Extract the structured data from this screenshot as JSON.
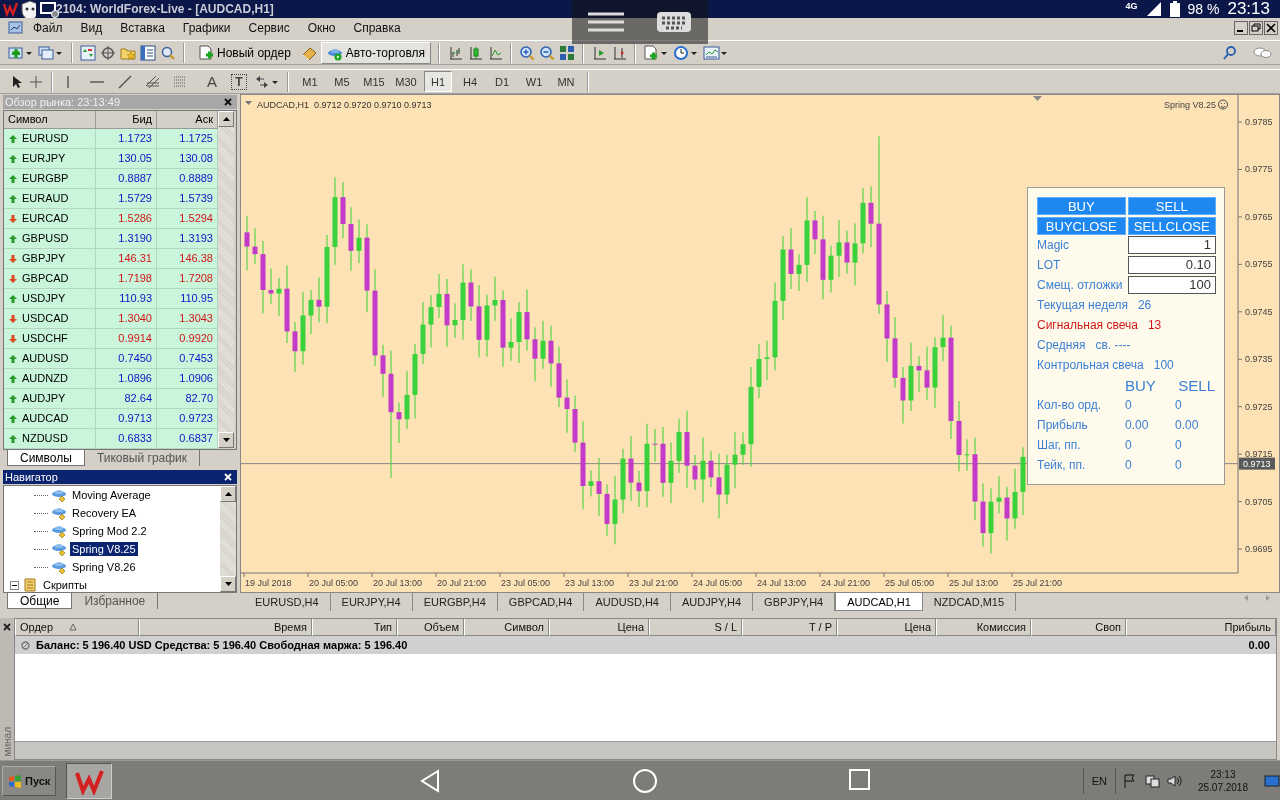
{
  "window": {
    "title": "2104: WorldForex-Live - [AUDCAD,H1]"
  },
  "android_status": {
    "network": "4G",
    "battery": "98 %",
    "time": "23:13"
  },
  "menu": [
    "Файл",
    "Вид",
    "Вставка",
    "Графики",
    "Сервис",
    "Окно",
    "Справка"
  ],
  "toolbar": {
    "new_order": "Новый ордер",
    "auto_trading": {
      "label": "Авто-торговля",
      "on": true
    }
  },
  "drawing_tools": {
    "text_tool": "A",
    "label_tool": "T"
  },
  "timeframes": [
    {
      "label": "M1",
      "selected": false
    },
    {
      "label": "M5",
      "selected": false
    },
    {
      "label": "M15",
      "selected": false
    },
    {
      "label": "M30",
      "selected": false
    },
    {
      "label": "H1",
      "selected": true
    },
    {
      "label": "H4",
      "selected": false
    },
    {
      "label": "D1",
      "selected": false
    },
    {
      "label": "W1",
      "selected": false
    },
    {
      "label": "MN",
      "selected": false
    }
  ],
  "market_watch": {
    "title": "Обзор рынка: 23:13:49",
    "columns": [
      "Символ",
      "Бид",
      "Аск"
    ],
    "rows": [
      {
        "symbol": "EURUSD",
        "bid": "1.1723",
        "ask": "1.1725",
        "kind": "up"
      },
      {
        "symbol": "EURJPY",
        "bid": "130.05",
        "ask": "130.08",
        "kind": "up"
      },
      {
        "symbol": "EURGBP",
        "bid": "0.8887",
        "ask": "0.8889",
        "kind": "up"
      },
      {
        "symbol": "EURAUD",
        "bid": "1.5729",
        "ask": "1.5739",
        "kind": "up"
      },
      {
        "symbol": "EURCAD",
        "bid": "1.5286",
        "ask": "1.5294",
        "kind": "down"
      },
      {
        "symbol": "GBPUSD",
        "bid": "1.3190",
        "ask": "1.3193",
        "kind": "up"
      },
      {
        "symbol": "GBPJPY",
        "bid": "146.31",
        "ask": "146.38",
        "kind": "down"
      },
      {
        "symbol": "GBPCAD",
        "bid": "1.7198",
        "ask": "1.7208",
        "kind": "down"
      },
      {
        "symbol": "USDJPY",
        "bid": "110.93",
        "ask": "110.95",
        "kind": "up"
      },
      {
        "symbol": "USDCAD",
        "bid": "1.3040",
        "ask": "1.3043",
        "kind": "down"
      },
      {
        "symbol": "USDCHF",
        "bid": "0.9914",
        "ask": "0.9920",
        "kind": "down"
      },
      {
        "symbol": "AUDUSD",
        "bid": "0.7450",
        "ask": "0.7453",
        "kind": "up"
      },
      {
        "symbol": "AUDNZD",
        "bid": "1.0896",
        "ask": "1.0906",
        "kind": "up"
      },
      {
        "symbol": "AUDJPY",
        "bid": "82.64",
        "ask": "82.70",
        "kind": "up"
      },
      {
        "symbol": "AUDCAD",
        "bid": "0.9713",
        "ask": "0.9723",
        "kind": "up"
      },
      {
        "symbol": "NZDUSD",
        "bid": "0.6833",
        "ask": "0.6837",
        "kind": "up"
      }
    ],
    "tabs": [
      {
        "label": "Символы",
        "selected": true
      },
      {
        "label": "Тиковый график",
        "selected": false
      }
    ]
  },
  "navigator": {
    "title": "Навигатор",
    "items": [
      {
        "label": "Moving Average",
        "selected": false
      },
      {
        "label": "Recovery EA",
        "selected": false
      },
      {
        "label": "Spring Mod 2.2",
        "selected": false
      },
      {
        "label": "Spring V8.25",
        "selected": true
      },
      {
        "label": "Spring V8.26",
        "selected": false
      }
    ],
    "folder": {
      "label": "Скрипты",
      "expanded": true
    },
    "tabs": [
      {
        "label": "Общие",
        "selected": true
      },
      {
        "label": "Избранное",
        "selected": false
      }
    ]
  },
  "chart": {
    "header": "AUDCAD,H1  0.9712 0.9720 0.9710 0.9713",
    "expert": "Spring V8.25",
    "price_ticks": [
      "0.9785",
      "0.9775",
      "0.9765",
      "0.9755",
      "0.9745",
      "0.9735",
      "0.9725",
      "0.9715",
      "0.9705",
      "0.9695"
    ],
    "current_price": "0.9713",
    "time_labels": [
      "19 Jul 2018",
      "20 Jul 05:00",
      "20 Jul 13:00",
      "20 Jul 21:00",
      "23 Jul 05:00",
      "23 Jul 13:00",
      "23 Jul 21:00",
      "24 Jul 05:00",
      "24 Jul 13:00",
      "24 Jul 21:00",
      "25 Jul 05:00",
      "25 Jul 13:00",
      "25 Jul 21:00"
    ],
    "panel": {
      "buttons": [
        "BUY",
        "SELL",
        "BUYCLOSE",
        "SELLCLOSE"
      ],
      "fields": [
        {
          "label": "Magic",
          "value": "1"
        },
        {
          "label": "LOT",
          "value": "0.10"
        },
        {
          "label": "Смещ. отложки",
          "value": "100"
        }
      ],
      "info": [
        {
          "label": "Текущая неделя",
          "value": "26",
          "color": "#3a7fd5"
        },
        {
          "label": "Сигнальная свеча",
          "value": "13",
          "color": "#d01818"
        },
        {
          "label": "Средняя",
          "value": "св. ----",
          "color": "#3a7fd5"
        },
        {
          "label": "Контрольная свеча",
          "value": "100",
          "color": "#3a7fd5"
        }
      ],
      "stats_columns": [
        "BUY",
        "SELL"
      ],
      "stats": [
        {
          "label": "Кол-во орд.",
          "buy": "0",
          "sell": "0"
        },
        {
          "label": "Прибыль",
          "buy": "0.00",
          "sell": "0.00"
        },
        {
          "label": "Шаг, пп.",
          "buy": "0",
          "sell": "0"
        },
        {
          "label": "Тейк, пп.",
          "buy": "0",
          "sell": "0"
        }
      ]
    }
  },
  "chart_tabs": [
    {
      "label": "EURUSD,H4",
      "selected": false
    },
    {
      "label": "EURJPY,H4",
      "selected": false
    },
    {
      "label": "EURGBP,H4",
      "selected": false
    },
    {
      "label": "GBPCAD,H4",
      "selected": false
    },
    {
      "label": "AUDUSD,H4",
      "selected": false
    },
    {
      "label": "AUDJPY,H4",
      "selected": false
    },
    {
      "label": "GBPJPY,H4",
      "selected": false
    },
    {
      "label": "AUDCAD,H1",
      "selected": true
    },
    {
      "label": "NZDCAD,M15",
      "selected": false
    }
  ],
  "terminal": {
    "tab": "минал",
    "columns": [
      "Ордер",
      "Время",
      "Тип",
      "Объем",
      "Символ",
      "Цена",
      "S / L",
      "T / P",
      "Цена",
      "Комиссия",
      "Своп",
      "Прибыль"
    ],
    "balance": "Баланс: 5 196.40 USD  Средства: 5 196.40  Свободная маржа: 5 196.40",
    "profit": "0.00"
  },
  "taskbar": {
    "start": "Пуск",
    "language": "EN",
    "time": "23:13",
    "date": "25.07.2018"
  }
}
